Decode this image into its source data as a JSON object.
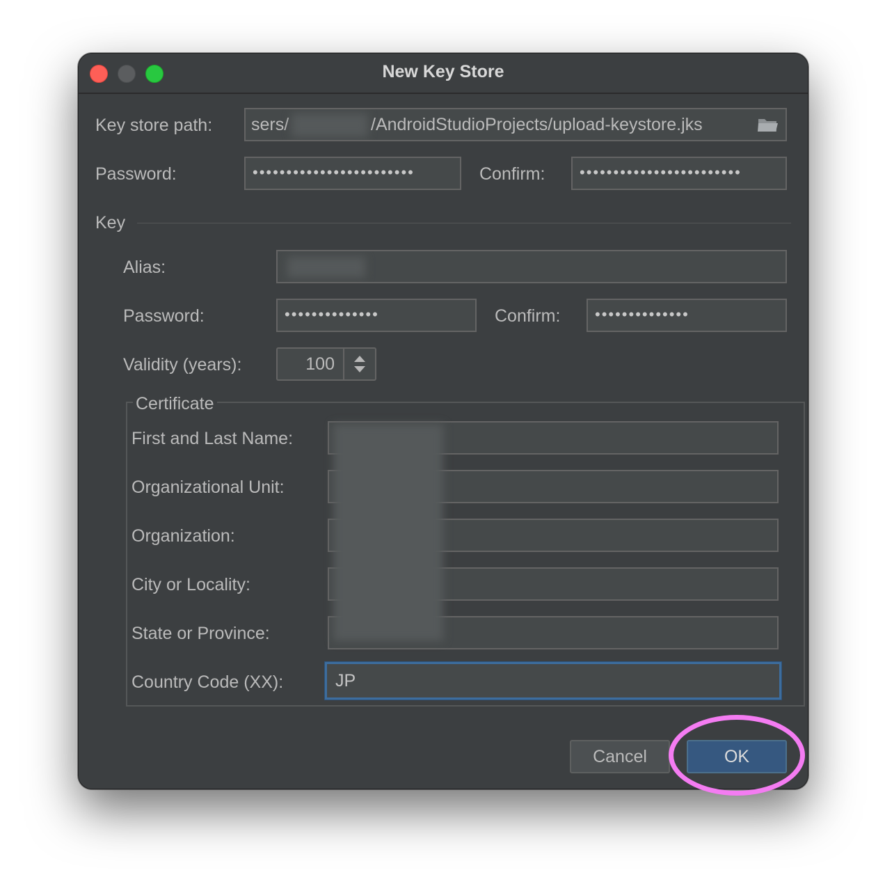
{
  "window": {
    "title": "New Key Store"
  },
  "keystore": {
    "path_label": "Key store path:",
    "path_value_left": "sers/",
    "path_value_right": "/AndroidStudioProjects/upload-keystore.jks",
    "password_label": "Password:",
    "password_mask": "••••••••••••••••••••••••",
    "confirm_label": "Confirm:",
    "confirm_mask": "••••••••••••••••••••••••"
  },
  "key": {
    "section_label": "Key",
    "alias_label": "Alias:",
    "password_label": "Password:",
    "password_mask": "••••••••••••••",
    "confirm_label": "Confirm:",
    "confirm_mask": "••••••••••••••",
    "validity_label": "Validity (years):",
    "validity_value": "100"
  },
  "certificate": {
    "group_label": "Certificate",
    "first_last_label": "First and Last Name:",
    "org_unit_label": "Organizational Unit:",
    "organization_label": "Organization:",
    "city_label": "City or Locality:",
    "state_label": "State or Province:",
    "country_label": "Country Code (XX):",
    "country_value": "JP"
  },
  "buttons": {
    "cancel": "Cancel",
    "ok": "OK"
  },
  "colors": {
    "dialog_bg": "#3c3f41",
    "field_bg": "#45494a",
    "focus_border": "#3d6d9e",
    "ok_bg": "#365880",
    "annotation": "#f47cf2"
  },
  "icons": {
    "path_browse": "folder-icon",
    "spinner": "spinner-arrows-icon"
  }
}
